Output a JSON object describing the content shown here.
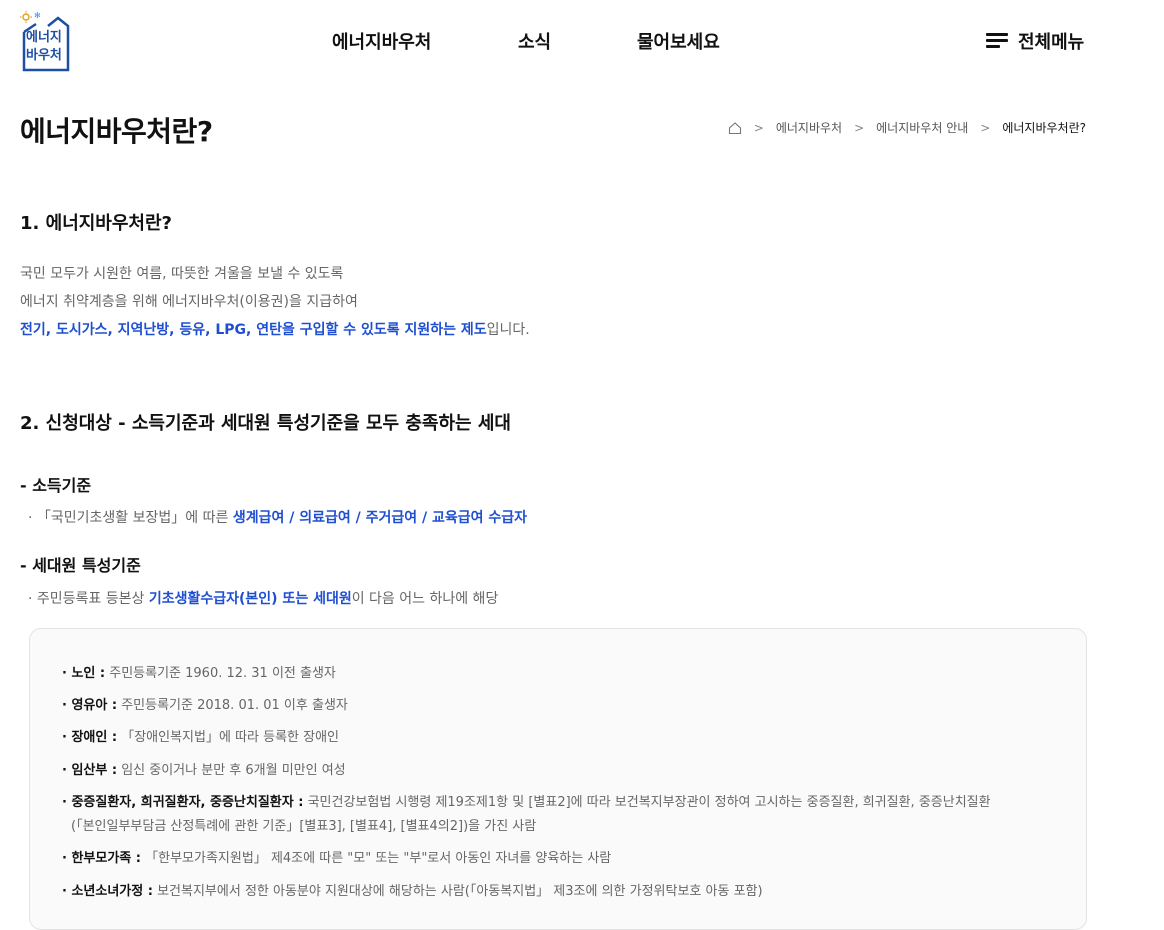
{
  "logo": {
    "line1": "에너지",
    "line2": "바우처"
  },
  "nav": [
    "에너지바우처",
    "소식",
    "물어보세요"
  ],
  "all_menu_label": "전체메뉴",
  "page_title": "에너지바우처란?",
  "breadcrumb": [
    "에너지바우처",
    "에너지바우처 안내",
    "에너지바우처란?"
  ],
  "section1": {
    "title": "1. 에너지바우처란?",
    "line1": "국민 모두가 시원한 여름, 따뜻한 겨울을 보낼 수 있도록",
    "line2": "에너지 취약계층을 위해 에너지바우처(이용권)을 지급하여",
    "line3_highlight": "전기, 도시가스, 지역난방, 등유, LPG, 연탄을 구입할 수 있도록 지원하는 제도",
    "line3_rest": "입니다."
  },
  "section2": {
    "title": "2. 신청대상 - 소득기준과 세대원 특성기준을 모두 충족하는 세대",
    "income": {
      "title": "- 소득기준",
      "prefix": "· 「국민기초생활 보장법」에 따른 ",
      "highlight": "생계급여 / 의료급여 / 주거급여 / 교육급여 수급자"
    },
    "household": {
      "title": "- 세대원 특성기준",
      "prefix": "· 주민등록표 등본상 ",
      "highlight": "기초생활수급자(본인) 또는 세대원",
      "suffix": "이 다음 어느 하나에 해당"
    },
    "criteria": [
      {
        "label": "· 노인 :",
        "text": " 주민등록기준 1960. 12. 31 이전 출생자"
      },
      {
        "label": "· 영유아 :",
        "text": " 주민등록기준 2018. 01. 01 이후 출생자"
      },
      {
        "label": "· 장애인 :",
        "text": " 「장애인복지법」에 따라 등록한 장애인"
      },
      {
        "label": "· 임산부 :",
        "text": " 임신 중이거나 분만 후 6개월 미만인 여성"
      },
      {
        "label": "· 중증질환자, 희귀질환자, 중증난치질환자 :",
        "text": " 국민건강보험법 시행령 제19조제1항 및 [별표2]에 따라 보건복지부장관이 정하여 고시하는 중증질환, 희귀질환, 중증난치질환",
        "text2": "(「본인일부부담금 산정특례에 관한 기준」[별표3], [별표4], [별표4의2])을 가진 사람"
      },
      {
        "label": "· 한부모가족 :",
        "text": " 「한부모가족지원법」 제4조에 따른 \"모\" 또는 \"부\"로서 아동인 자녀를 양육하는 사람"
      },
      {
        "label": "· 소년소녀가정 :",
        "text": " 보건복지부에서 정한 아동분야 지원대상에 해당하는 사람(「아동복지법」 제3조에 의한 가정위탁보호 아동 포함)"
      }
    ]
  },
  "colors": {
    "brand": "#1e4fa3",
    "highlight": "#1f4fd1"
  }
}
